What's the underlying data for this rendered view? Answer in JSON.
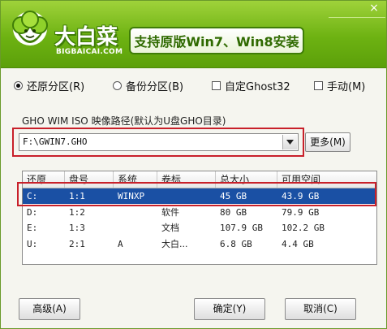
{
  "header": {
    "brand_name": "大白菜",
    "brand_url": "BIGBAICAI.COM",
    "banner_text": "支持原版Win7、Win8安装",
    "close_glyph": "×"
  },
  "mode_options": [
    {
      "label": "还原分区(R)",
      "selected": true
    },
    {
      "label": "备份分区(B)",
      "selected": false
    }
  ],
  "check_options": [
    {
      "label": "自定Ghost32",
      "checked": false
    },
    {
      "label": "手动(M)",
      "checked": false
    }
  ],
  "image_path": {
    "label": "GHO WIM ISO 映像路径(默认为U盘GHO目录)",
    "value": "F:\\GWIN7.GHO",
    "more_button": "更多(M)"
  },
  "partition_table": {
    "columns": [
      "还原",
      "盘号",
      "系统",
      "卷标",
      "总大小",
      "可用空间"
    ],
    "rows": [
      {
        "restore": "C:",
        "disk": "1:1",
        "system": "WINXP",
        "volume": "",
        "total": "45 GB",
        "free": "43.9 GB",
        "selected": true
      },
      {
        "restore": "D:",
        "disk": "1:2",
        "system": "",
        "volume": "软件",
        "total": "80 GB",
        "free": "79.9 GB",
        "selected": false
      },
      {
        "restore": "E:",
        "disk": "1:3",
        "system": "",
        "volume": "文档",
        "total": "107.9 GB",
        "free": "102.2 GB",
        "selected": false
      },
      {
        "restore": "U:",
        "disk": "2:1",
        "system": "A",
        "volume": "大白...",
        "total": "6.8 GB",
        "free": "4.4 GB",
        "selected": false
      }
    ]
  },
  "buttons": {
    "advanced": "高级(A)",
    "ok": "确定(Y)",
    "cancel": "取消(C)"
  },
  "colors": {
    "header_green": "#6db212",
    "selection_blue": "#1a50a4",
    "highlight_red": "#c8202a"
  }
}
